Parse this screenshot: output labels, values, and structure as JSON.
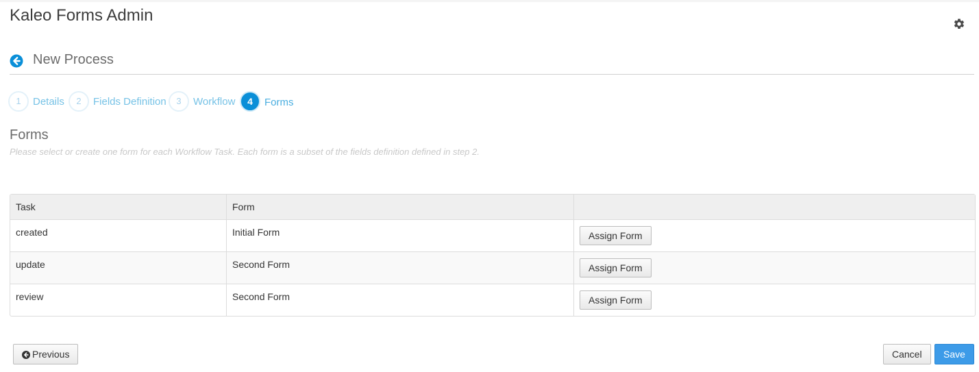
{
  "app": {
    "title": "Kaleo Forms Admin",
    "settings_icon": "gear-icon"
  },
  "header": {
    "back_icon": "back-arrow-icon",
    "title": "New Process"
  },
  "steps": [
    {
      "number": "1",
      "label": "Details",
      "state": "done"
    },
    {
      "number": "2",
      "label": "Fields Definition",
      "state": "done"
    },
    {
      "number": "3",
      "label": "Workflow",
      "state": "done"
    },
    {
      "number": "4",
      "label": "Forms",
      "state": "active"
    }
  ],
  "section": {
    "title": "Forms",
    "help": "Please select or create one form for each Workflow Task. Each form is a subset of the fields definition defined in step 2."
  },
  "table": {
    "columns": [
      "Task",
      "Form",
      ""
    ],
    "rows": [
      {
        "task": "created",
        "form": "Initial Form",
        "action": "Assign Form"
      },
      {
        "task": "update",
        "form": "Second Form",
        "action": "Assign Form"
      },
      {
        "task": "review",
        "form": "Second Form",
        "action": "Assign Form"
      }
    ]
  },
  "footer": {
    "previous_label": "Previous",
    "cancel_label": "Cancel",
    "save_label": "Save"
  },
  "colors": {
    "accent": "#0a8fd8",
    "primary_button": "#3d9be8",
    "step_label": "#76c2e6"
  }
}
